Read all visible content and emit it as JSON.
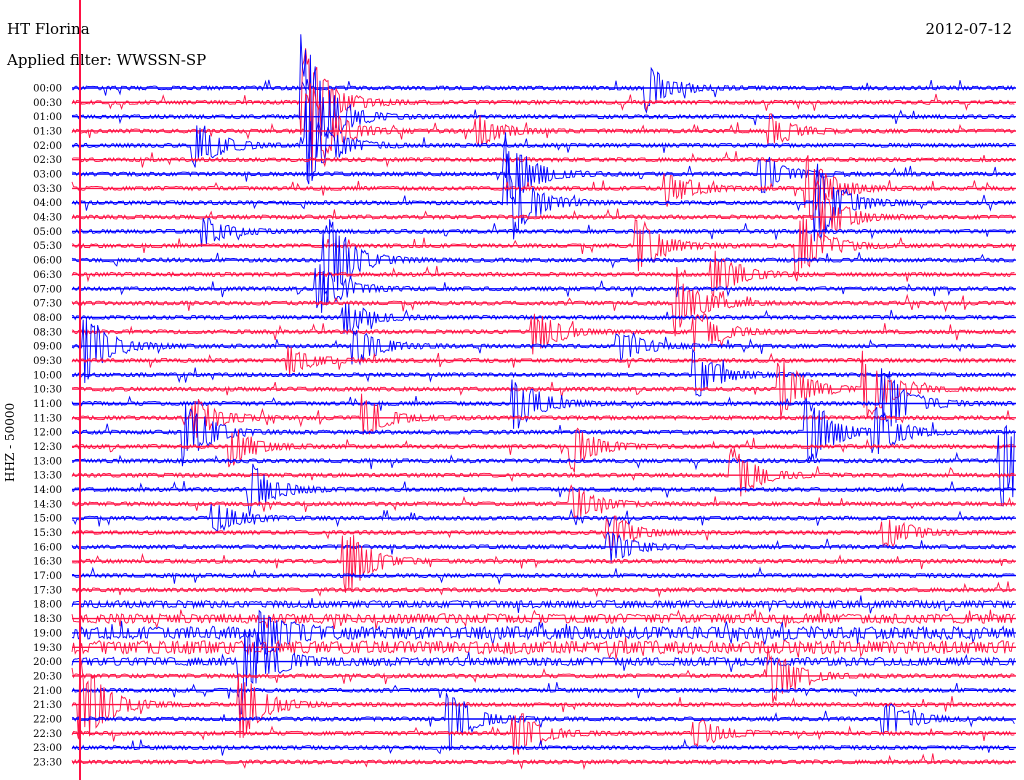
{
  "header": {
    "station": "HT Florina",
    "date": "2012-07-12",
    "filter": "Applied filter: WWSSN-SP"
  },
  "colors": {
    "even_rows": "#0000ff",
    "odd_rows": "#ff1144",
    "marker": "#ff1144"
  },
  "chart_data": {
    "type": "line",
    "title": "HT Florina",
    "ylabel": "HHZ - 50000",
    "row_interval_minutes": 30,
    "rows": [
      "00:00",
      "00:30",
      "01:00",
      "01:30",
      "02:00",
      "02:30",
      "03:00",
      "03:30",
      "04:00",
      "04:30",
      "05:00",
      "05:30",
      "06:00",
      "06:30",
      "07:00",
      "07:30",
      "08:00",
      "08:30",
      "09:00",
      "09:30",
      "10:00",
      "10:30",
      "11:00",
      "11:30",
      "12:00",
      "12:30",
      "13:00",
      "13:30",
      "14:00",
      "14:30",
      "15:00",
      "15:30",
      "16:00",
      "16:30",
      "17:00",
      "17:30",
      "18:00",
      "18:30",
      "19:00",
      "19:30",
      "20:00",
      "20:30",
      "21:00",
      "21:30",
      "22:00",
      "22:30",
      "23:00",
      "23:30"
    ],
    "events": [
      {
        "row": 0,
        "pos": 0.61,
        "amp": 1.6
      },
      {
        "row": 1,
        "pos": 0.245,
        "amp": 4.5
      },
      {
        "row": 2,
        "pos": 0.245,
        "amp": 6
      },
      {
        "row": 3,
        "pos": 0.25,
        "amp": 4
      },
      {
        "row": 3,
        "pos": 0.43,
        "amp": 1.2
      },
      {
        "row": 3,
        "pos": 0.74,
        "amp": 1.2
      },
      {
        "row": 4,
        "pos": 0.13,
        "amp": 2
      },
      {
        "row": 4,
        "pos": 0.25,
        "amp": 3
      },
      {
        "row": 6,
        "pos": 0.46,
        "amp": 3
      },
      {
        "row": 6,
        "pos": 0.73,
        "amp": 1.6
      },
      {
        "row": 7,
        "pos": 0.63,
        "amp": 1.4
      },
      {
        "row": 7,
        "pos": 0.78,
        "amp": 2.5
      },
      {
        "row": 8,
        "pos": 0.46,
        "amp": 3.5
      },
      {
        "row": 8,
        "pos": 0.79,
        "amp": 3
      },
      {
        "row": 9,
        "pos": 0.79,
        "amp": 2.5
      },
      {
        "row": 10,
        "pos": 0.14,
        "amp": 1
      },
      {
        "row": 11,
        "pos": 0.6,
        "amp": 2
      },
      {
        "row": 11,
        "pos": 0.77,
        "amp": 2.5
      },
      {
        "row": 12,
        "pos": 0.27,
        "amp": 3.5
      },
      {
        "row": 13,
        "pos": 0.68,
        "amp": 1.8
      },
      {
        "row": 14,
        "pos": 0.26,
        "amp": 2
      },
      {
        "row": 15,
        "pos": 0.64,
        "amp": 2.5
      },
      {
        "row": 16,
        "pos": 0.29,
        "amp": 1.2
      },
      {
        "row": 17,
        "pos": 0.49,
        "amp": 1.6
      },
      {
        "row": 17,
        "pos": 0.66,
        "amp": 1.8
      },
      {
        "row": 18,
        "pos": 0.015,
        "amp": 2.6
      },
      {
        "row": 18,
        "pos": 0.3,
        "amp": 1.4
      },
      {
        "row": 18,
        "pos": 0.58,
        "amp": 1.2
      },
      {
        "row": 19,
        "pos": 0.23,
        "amp": 1
      },
      {
        "row": 20,
        "pos": 0.66,
        "amp": 1.8
      },
      {
        "row": 21,
        "pos": 0.75,
        "amp": 2.5
      },
      {
        "row": 21,
        "pos": 0.84,
        "amp": 2.5
      },
      {
        "row": 22,
        "pos": 0.47,
        "amp": 2
      },
      {
        "row": 22,
        "pos": 0.86,
        "amp": 2.5
      },
      {
        "row": 23,
        "pos": 0.13,
        "amp": 1.5
      },
      {
        "row": 23,
        "pos": 0.31,
        "amp": 1.6
      },
      {
        "row": 24,
        "pos": 0.12,
        "amp": 2.5
      },
      {
        "row": 24,
        "pos": 0.78,
        "amp": 2.5
      },
      {
        "row": 24,
        "pos": 0.85,
        "amp": 1.8
      },
      {
        "row": 25,
        "pos": 0.17,
        "amp": 1.4
      },
      {
        "row": 25,
        "pos": 0.53,
        "amp": 1.6
      },
      {
        "row": 26,
        "pos": 0.985,
        "amp": 3.5
      },
      {
        "row": 27,
        "pos": 0.7,
        "amp": 2
      },
      {
        "row": 28,
        "pos": 0.19,
        "amp": 1.8
      },
      {
        "row": 29,
        "pos": 0.53,
        "amp": 1.4
      },
      {
        "row": 30,
        "pos": 0.15,
        "amp": 1.2
      },
      {
        "row": 31,
        "pos": 0.57,
        "amp": 1.4
      },
      {
        "row": 31,
        "pos": 0.86,
        "amp": 1.4
      },
      {
        "row": 32,
        "pos": 0.57,
        "amp": 1.2
      },
      {
        "row": 33,
        "pos": 0.29,
        "amp": 2.5
      },
      {
        "row": 38,
        "pos": 0.2,
        "amp": 2
      },
      {
        "row": 40,
        "pos": 0.18,
        "amp": 3.5
      },
      {
        "row": 41,
        "pos": 0.74,
        "amp": 2.2
      },
      {
        "row": 43,
        "pos": 0.01,
        "amp": 3.5
      },
      {
        "row": 43,
        "pos": 0.18,
        "amp": 2.5
      },
      {
        "row": 44,
        "pos": 0.4,
        "amp": 2.2
      },
      {
        "row": 44,
        "pos": 0.86,
        "amp": 1.4
      },
      {
        "row": 45,
        "pos": 0.47,
        "amp": 1.8
      },
      {
        "row": 45,
        "pos": 0.66,
        "amp": 1.2
      }
    ],
    "noise_levels": {
      "36": 1.2,
      "37": 2.0,
      "38": 3.0,
      "39": 3.2,
      "40": 1.6
    }
  }
}
